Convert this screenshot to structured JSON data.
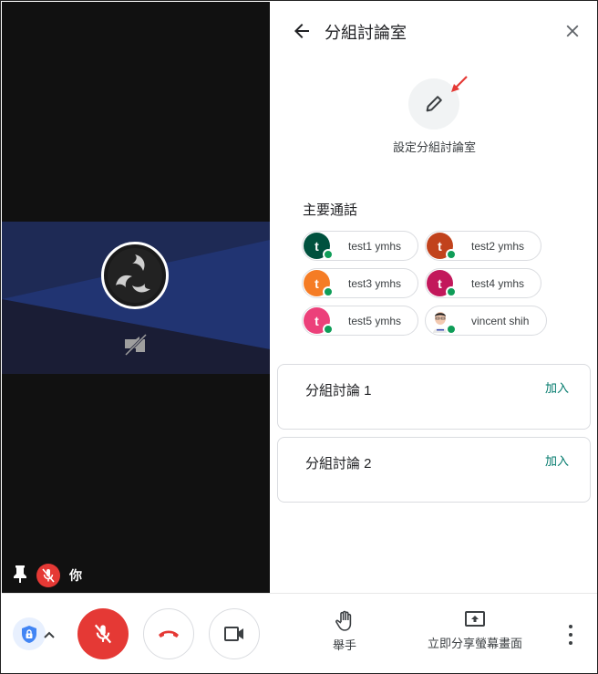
{
  "video": {
    "self_name": "你",
    "participant_logo": "obs-logo",
    "camera_state": "camera-off"
  },
  "panel": {
    "title": "分組討論室",
    "back_icon": "arrow-back-icon",
    "close_icon": "close-icon",
    "setup_label": "設定分組討論室",
    "main_call_title": "主要通話",
    "participants": [
      {
        "name": "test1 ymhs",
        "initial": "t",
        "color": "#00513e",
        "status": "online"
      },
      {
        "name": "test2 ymhs",
        "initial": "t",
        "color": "#c1421c",
        "status": "online"
      },
      {
        "name": "test3 ymhs",
        "initial": "t",
        "color": "#f57c25",
        "status": "online"
      },
      {
        "name": "test4 ymhs",
        "initial": "t",
        "color": "#c2185b",
        "status": "online"
      },
      {
        "name": "test5 ymhs",
        "initial": "t",
        "color": "#ec407a",
        "status": "online"
      },
      {
        "name": "vincent shih",
        "initial": "",
        "color": "#ffffff",
        "status": "online",
        "photo": true
      }
    ],
    "rooms": [
      {
        "name": "分組討論 1",
        "join_label": "加入"
      },
      {
        "name": "分組討論 2",
        "join_label": "加入"
      }
    ]
  },
  "toolbar": {
    "raise_hand_label": "舉手",
    "present_label": "立即分享螢幕畫面",
    "mic_state": "muted",
    "colors": {
      "danger": "#e53935",
      "accent": "#00796b",
      "status_online": "#0f9d58"
    }
  }
}
